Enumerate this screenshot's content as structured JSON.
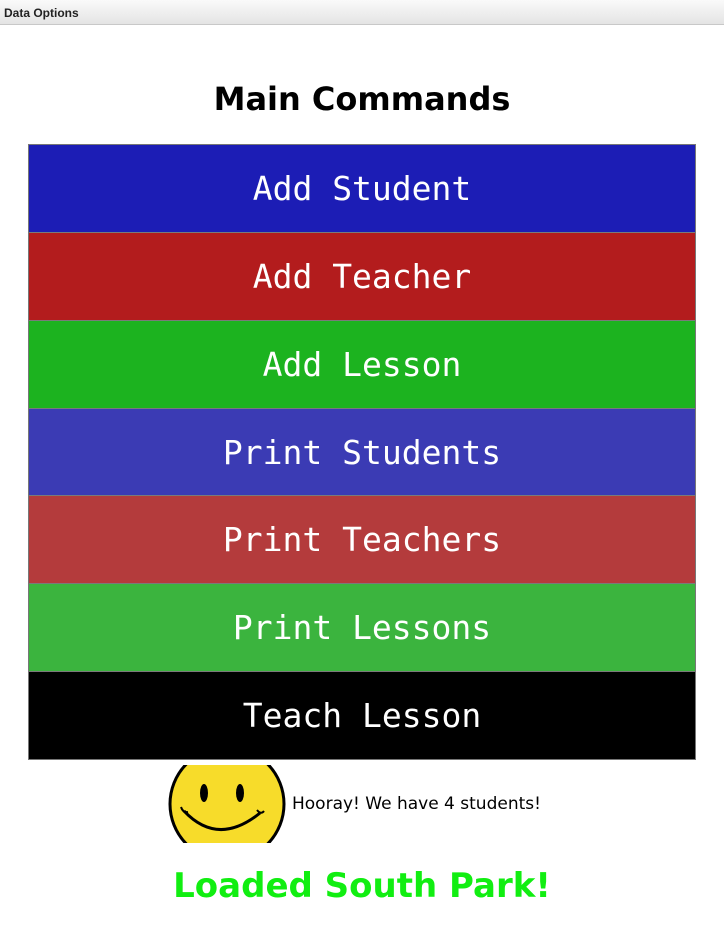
{
  "window": {
    "title": "Data Options"
  },
  "main": {
    "heading": "Main Commands",
    "commands": [
      {
        "label": "Add Student",
        "color": "#1c1db5"
      },
      {
        "label": "Add Teacher",
        "color": "#b31c1d"
      },
      {
        "label": "Add Lesson",
        "color": "#1cb31f"
      },
      {
        "label": "Print Students",
        "color": "#3b3bb4"
      },
      {
        "label": "Print Teachers",
        "color": "#b43b3c"
      },
      {
        "label": "Print Lessons",
        "color": "#3bb43e"
      },
      {
        "label": "Teach Lesson",
        "color": "#000000"
      }
    ]
  },
  "status": {
    "icon": "smiley-face-icon",
    "message": "Hooray! We have 4 students!",
    "loaded_message": "Loaded South Park!",
    "loaded_color": "#11ee11"
  }
}
